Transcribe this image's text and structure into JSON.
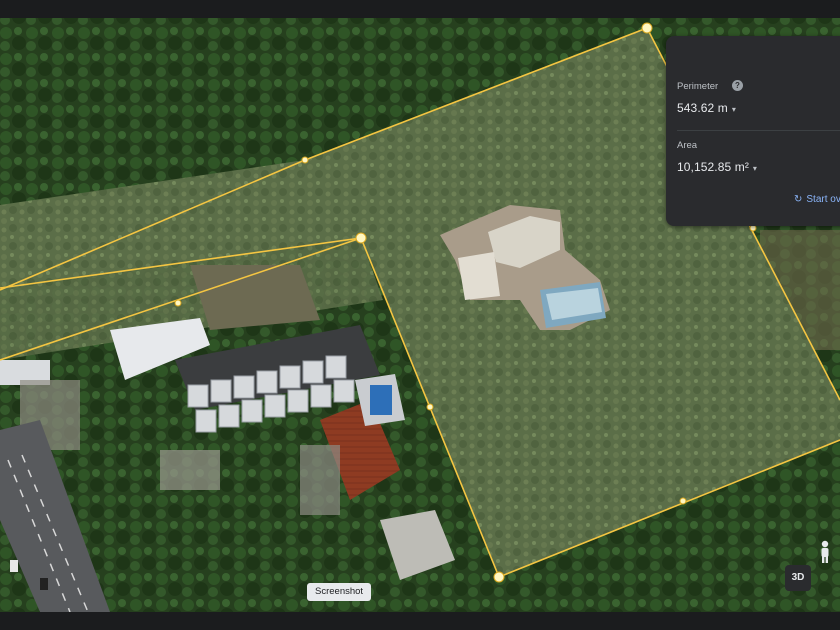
{
  "panel": {
    "perimeter_label": "Perimeter",
    "perimeter_value": "543.62 m",
    "area_label": "Area",
    "area_value": "10,152.85 m²",
    "start_label": "Start ov"
  },
  "map_controls": {
    "screenshot_chip": "Screenshot",
    "view_3d_label": "3D"
  },
  "icons": {
    "help": "help-icon",
    "dropdown": "caret-down-icon",
    "restart": "restart-icon",
    "pegman": "pegman-icon"
  },
  "colors": {
    "measure_line": "#f4c542",
    "vertex": "#fff7c2",
    "panel_bg": "#2a2b2e",
    "link": "#8ab4f8"
  }
}
